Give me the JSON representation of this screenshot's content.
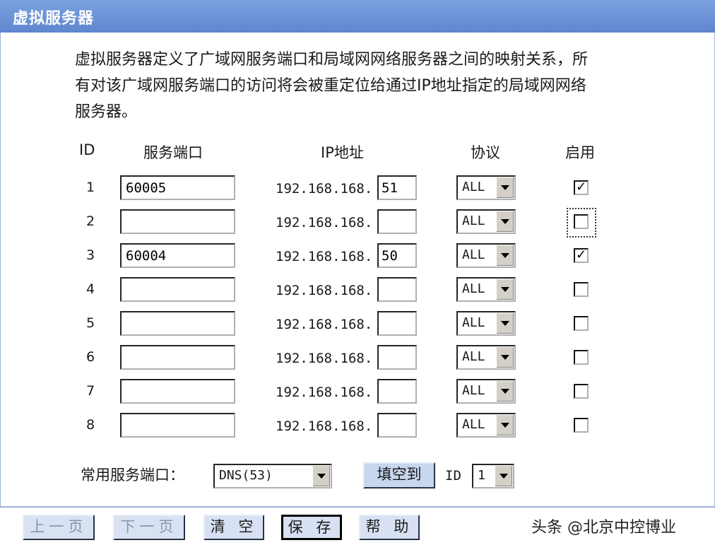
{
  "window": {
    "title": "虚拟服务器"
  },
  "intro": {
    "lines": [
      "虚拟服务器定义了广域网服务端口和局域网网络服务器之间的映射关系，所",
      "有对该广域网服务端口的访问将会被重定位给通过IP地址指定的局域网网络",
      "服务器。"
    ]
  },
  "table": {
    "headers": {
      "id": "ID",
      "port": "服务端口",
      "ip": "IP地址",
      "protocol": "协议",
      "enabled": "启用"
    },
    "ip_prefix": "192.168.168.",
    "rows": [
      {
        "id": "1",
        "port": "60005",
        "ip_last": "51",
        "protocol": "ALL",
        "enabled": true
      },
      {
        "id": "2",
        "port": "",
        "ip_last": "",
        "protocol": "ALL",
        "enabled": false
      },
      {
        "id": "3",
        "port": "60004",
        "ip_last": "50",
        "protocol": "ALL",
        "enabled": true
      },
      {
        "id": "4",
        "port": "",
        "ip_last": "",
        "protocol": "ALL",
        "enabled": false
      },
      {
        "id": "5",
        "port": "",
        "ip_last": "",
        "protocol": "ALL",
        "enabled": false
      },
      {
        "id": "6",
        "port": "",
        "ip_last": "",
        "protocol": "ALL",
        "enabled": false
      },
      {
        "id": "7",
        "port": "",
        "ip_last": "",
        "protocol": "ALL",
        "enabled": false
      },
      {
        "id": "8",
        "port": "",
        "ip_last": "",
        "protocol": "ALL",
        "enabled": false
      }
    ]
  },
  "common": {
    "label": "常用服务端口：",
    "service_selected": "DNS(53)",
    "fill_button": "填空到",
    "id_label": "ID",
    "id_selected": "1"
  },
  "buttons": {
    "prev": "上一页",
    "next": "下一页",
    "clear": "清 空",
    "save": "保 存",
    "help": "帮 助"
  },
  "watermark": "头条 @北京中控博业",
  "colors": {
    "titlebar": "#6b8fd6",
    "accent_border": "#9db3d6",
    "button_face": "#d7e1f3"
  }
}
